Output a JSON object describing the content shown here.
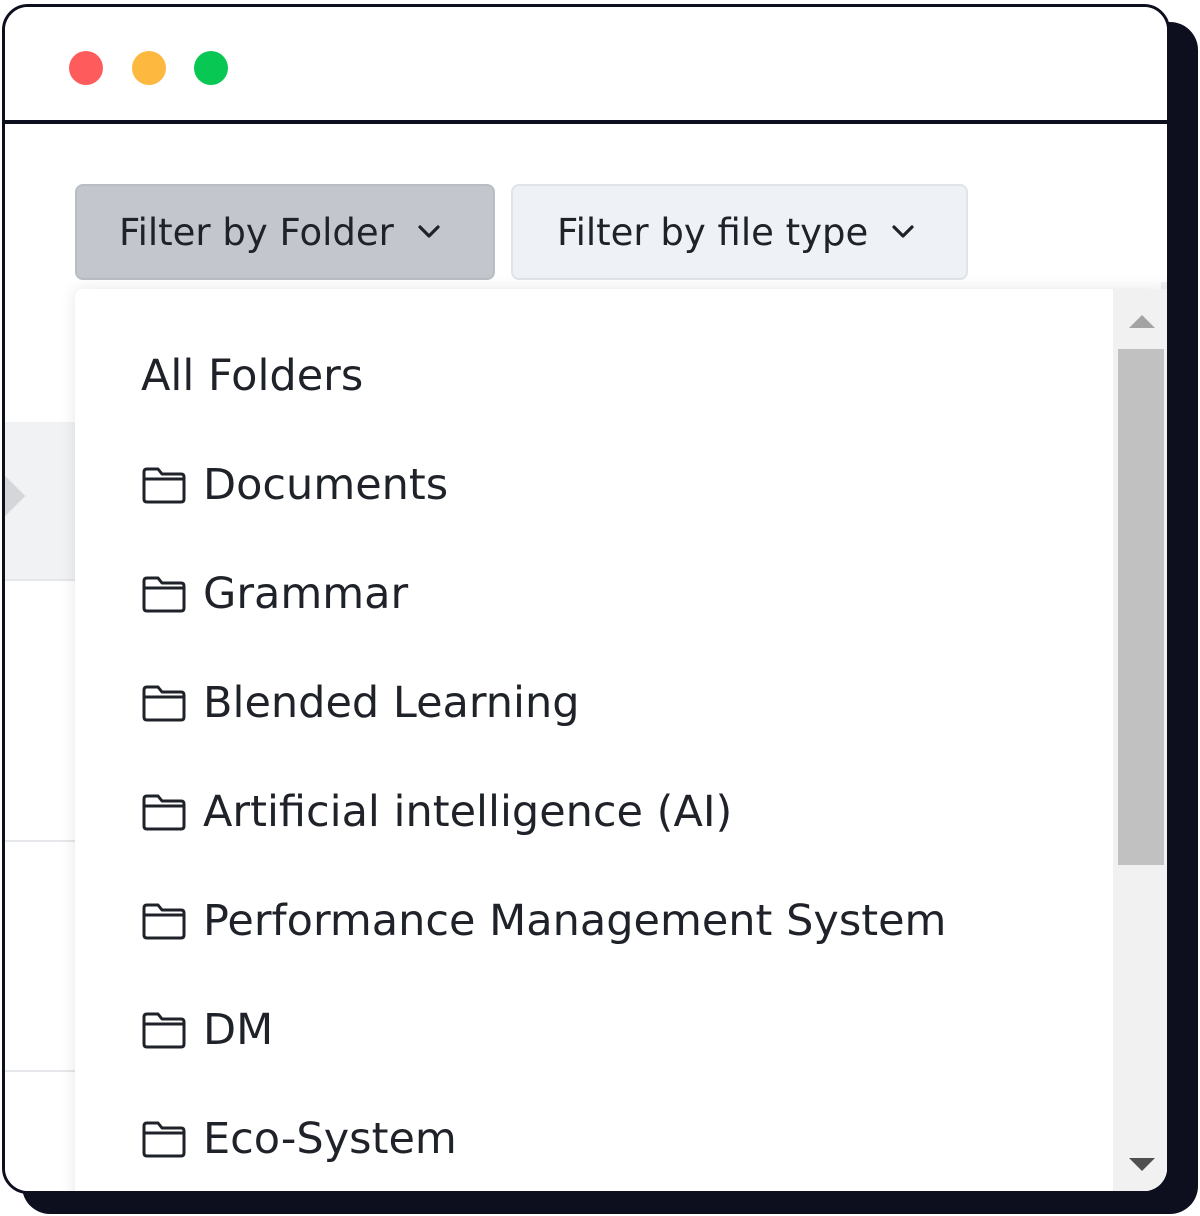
{
  "window": {
    "controls": [
      {
        "name": "close",
        "color": "#fe5c5c"
      },
      {
        "name": "minimize",
        "color": "#fdb840"
      },
      {
        "name": "maximize",
        "color": "#08c853"
      }
    ]
  },
  "filters": {
    "folder_label": "Filter by Folder",
    "type_label": "Filter by file type",
    "folder_active": true
  },
  "dropdown": {
    "all_label": "All Folders",
    "folders": [
      "Documents",
      "Grammar",
      "Blended Learning",
      "Artificial intelligence (AI)",
      "Performance Management System",
      "DM",
      "Eco-System"
    ]
  },
  "colors": {
    "frame": "#0d0f1e",
    "active_button": "#c3c7cd",
    "inactive_button": "#eef2f7",
    "text": "#1f2329"
  }
}
